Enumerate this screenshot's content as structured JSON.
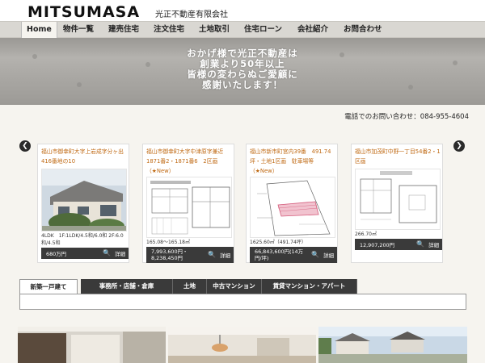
{
  "header": {
    "logo": "MITSUMASA",
    "company": "光正不動産有限会社"
  },
  "nav": {
    "items": [
      {
        "label": "Home",
        "active": true
      },
      {
        "label": "物件一覧"
      },
      {
        "label": "建売住宅"
      },
      {
        "label": "注文住宅"
      },
      {
        "label": "土地取引"
      },
      {
        "label": "住宅ローン"
      },
      {
        "label": "会社紹介"
      },
      {
        "label": "お問合わせ"
      }
    ]
  },
  "hero": {
    "lines": [
      "おかげ様で光正不動産は",
      "創業より50年以上",
      "皆様の変わらぬご愛顧に",
      "感謝いたします！"
    ]
  },
  "contact": {
    "phone": "電話でのお問い合わせ：084-955-4604"
  },
  "carousel": {
    "prev_icon": "chevron-left-icon",
    "next_icon": "chevron-right-icon",
    "cards": [
      {
        "title": "福山市御幸町大字上岩成字分ヶ出416番地の10",
        "image": "house-photo",
        "desc": "4LDK　1F:1LDK/4.5和/6.0和 2F:6.0和/4.5和",
        "price": "680万円",
        "detail": "詳細"
      },
      {
        "title": "福山市御幸町大字中津原字兼近1871番2・1871番6　2区画（★New）",
        "image": "floor-plan",
        "desc": "165.08～165.18㎡",
        "price": "7,993,600円・8,238,450円",
        "detail": "詳細"
      },
      {
        "title": "福山市新市町宮内39番　491.74坪・土地1区画　駐車場等（★New）",
        "image": "lot-plan",
        "desc": "1625.60㎡（491.74坪）",
        "price": "66,843,600円(14万円/坪)",
        "detail": "詳細"
      },
      {
        "title": "福山市加茂町中野一丁目54番2・1区画",
        "image": "site-plan",
        "desc": "266.70㎡",
        "price": "12,907,200円",
        "detail": "詳細"
      }
    ]
  },
  "tabs": [
    {
      "label": "新築一戸建て",
      "active": true
    },
    {
      "label": "事務所・店舗・倉庫"
    },
    {
      "label": "土地"
    },
    {
      "label": "中古マンション"
    },
    {
      "label": "賃貸マンション・アパート"
    }
  ],
  "colors": {
    "accent_title": "#c06a14",
    "nav_bg": "#d9d7d2",
    "dark_bar": "#3a3a3a"
  }
}
